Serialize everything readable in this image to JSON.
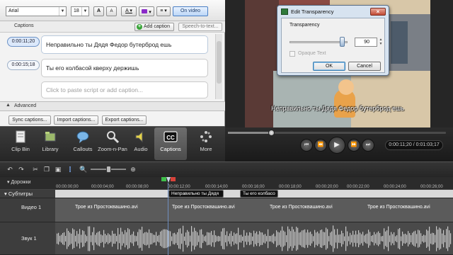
{
  "format_bar": {
    "font": "Arial",
    "size": "18",
    "grow_label": "A",
    "shrink_label": "A",
    "font_color_label": "A",
    "on_video_label": "On video"
  },
  "captions_panel": {
    "title": "Captions",
    "add_caption_label": "Add caption",
    "speech_to_text_label": "Speech-to-text...",
    "items": [
      {
        "time": "0:00:11;20",
        "text": "Неправильно ты Дядя Федор бутерброд ешь"
      },
      {
        "time": "0:00:15;18",
        "text": "Ты его колбасой кверху держишь"
      }
    ],
    "paste_placeholder": "Click to paste script or add caption...",
    "advanced_label": "Advanced",
    "sync_label": "Sync captions...",
    "import_label": "Import captions...",
    "export_label": "Export captions..."
  },
  "tools": [
    {
      "label": "Clip Bin",
      "icon": "clip-bin-icon"
    },
    {
      "label": "Library",
      "icon": "library-icon"
    },
    {
      "label": "Callouts",
      "icon": "callouts-icon"
    },
    {
      "label": "Zoom-n-Pan",
      "icon": "zoom-icon"
    },
    {
      "label": "Audio",
      "icon": "audio-icon"
    },
    {
      "label": "Captions",
      "icon": "cc-icon"
    },
    {
      "label": "More",
      "icon": "more-icon"
    }
  ],
  "dialog": {
    "title": "Edit Transparency",
    "transparency_label": "Transparency",
    "value": "90",
    "value_fraction": 0.9,
    "opaque_label": "Opaque Text",
    "ok_label": "OK",
    "cancel_label": "Cancel"
  },
  "preview": {
    "subtitle": "Неправильно ты Дядя Федор бутерброд ешь"
  },
  "player": {
    "time": "0:00:11;20 / 0:01:03;17",
    "progress_fraction": 0.18
  },
  "timeline": {
    "tracks_label": "Дорожки",
    "ticks": [
      "00:00:00;00",
      "00:00:04;00",
      "00:00:08;00",
      "00:00:10;00",
      "00:00:12;00",
      "00:00:14;00",
      "00:00:16;00",
      "00:00:18;00",
      "00:00:20;00",
      "00:00:22;00",
      "00:00:24;00",
      "00:00:26;00"
    ],
    "captions_track": "Субтитры",
    "caption_clips": [
      "Неправильно ты Дядя",
      "Ты его колбасо"
    ],
    "video_track": "Видео 1",
    "video_clips": [
      "Трое из Простоквашино.avi",
      "Трое из Простоквашино.avi",
      "Трое из Простоквашино.avi",
      "Трое из Простоквашино.avi"
    ],
    "audio_track": "Звук 1"
  },
  "colors": {
    "accent_blue": "#4a7fc4",
    "timeline_bg": "#2b2b2b"
  }
}
